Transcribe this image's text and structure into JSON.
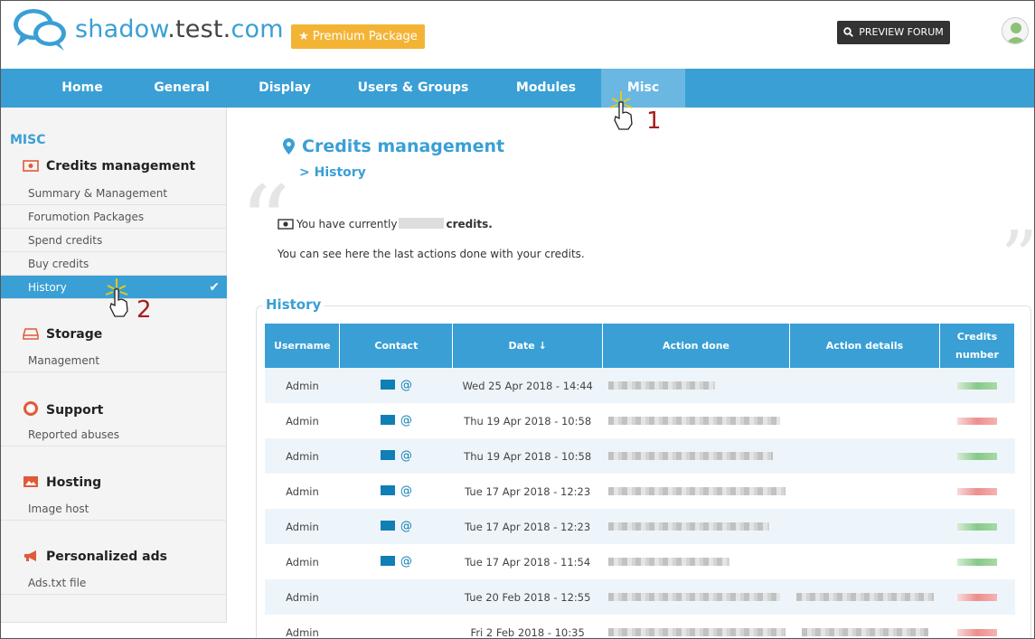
{
  "header": {
    "logo": {
      "part1": "shadow",
      "dot1": ".",
      "part2": "test",
      "dot2": ".",
      "part3": "com"
    },
    "premium_label": "Premium Package",
    "preview_label": "PREVIEW FORUM"
  },
  "nav": {
    "items": [
      "Home",
      "General",
      "Display",
      "Users & Groups",
      "Modules",
      "Misc"
    ],
    "active": "Misc"
  },
  "sidebar": {
    "section_title": "MISC",
    "groups": [
      {
        "title": "Credits management",
        "icon": "banknote-icon",
        "links": [
          "Summary & Management",
          "Forumotion Packages",
          "Spend credits",
          "Buy credits",
          "History"
        ]
      },
      {
        "title": "Storage",
        "icon": "drive-icon",
        "links": [
          "Management"
        ]
      },
      {
        "title": "Support",
        "icon": "lifebuoy-icon",
        "links": [
          "Reported abuses"
        ]
      },
      {
        "title": "Hosting",
        "icon": "image-icon",
        "links": [
          "Image host"
        ]
      },
      {
        "title": "Personalized ads",
        "icon": "megaphone-icon",
        "links": [
          "Ads.txt file"
        ]
      }
    ],
    "active_link": "History"
  },
  "main": {
    "title": "Credits management",
    "subtitle": "History",
    "subtitle_prefix": ">",
    "credit_prefix": "You have currently",
    "credit_suffix": "credits.",
    "info": "You can see here the last actions done with your credits.",
    "history_legend": "History"
  },
  "table": {
    "headers": [
      "Username",
      "Contact",
      "Date",
      "Action done",
      "Action details",
      "Credits number"
    ],
    "rows": [
      {
        "username": "Admin",
        "contact": true,
        "date": "Wed 25 Apr 2018 - 14:44",
        "credit": "plus"
      },
      {
        "username": "Admin",
        "contact": true,
        "date": "Thu 19 Apr 2018 - 10:58",
        "credit": "minus"
      },
      {
        "username": "Admin",
        "contact": true,
        "date": "Thu 19 Apr 2018 - 10:58",
        "credit": "plus"
      },
      {
        "username": "Admin",
        "contact": true,
        "date": "Tue 17 Apr 2018 - 12:23",
        "credit": "minus"
      },
      {
        "username": "Admin",
        "contact": true,
        "date": "Tue 17 Apr 2018 - 12:23",
        "credit": "plus"
      },
      {
        "username": "Admin",
        "contact": true,
        "date": "Tue 17 Apr 2018 - 11:54",
        "credit": "plus"
      },
      {
        "username": "Admin",
        "contact": false,
        "date": "Tue 20 Feb 2018 - 12:55",
        "credit": "minus"
      },
      {
        "username": "Admin",
        "contact": false,
        "date": "Fri 2 Feb 2018 - 10:35",
        "credit": "minus"
      }
    ]
  },
  "annotations": {
    "step1": "1",
    "step2": "2"
  },
  "colors": {
    "primary": "#3a9fd5",
    "premium": "#f3b436",
    "dark": "#333333"
  }
}
